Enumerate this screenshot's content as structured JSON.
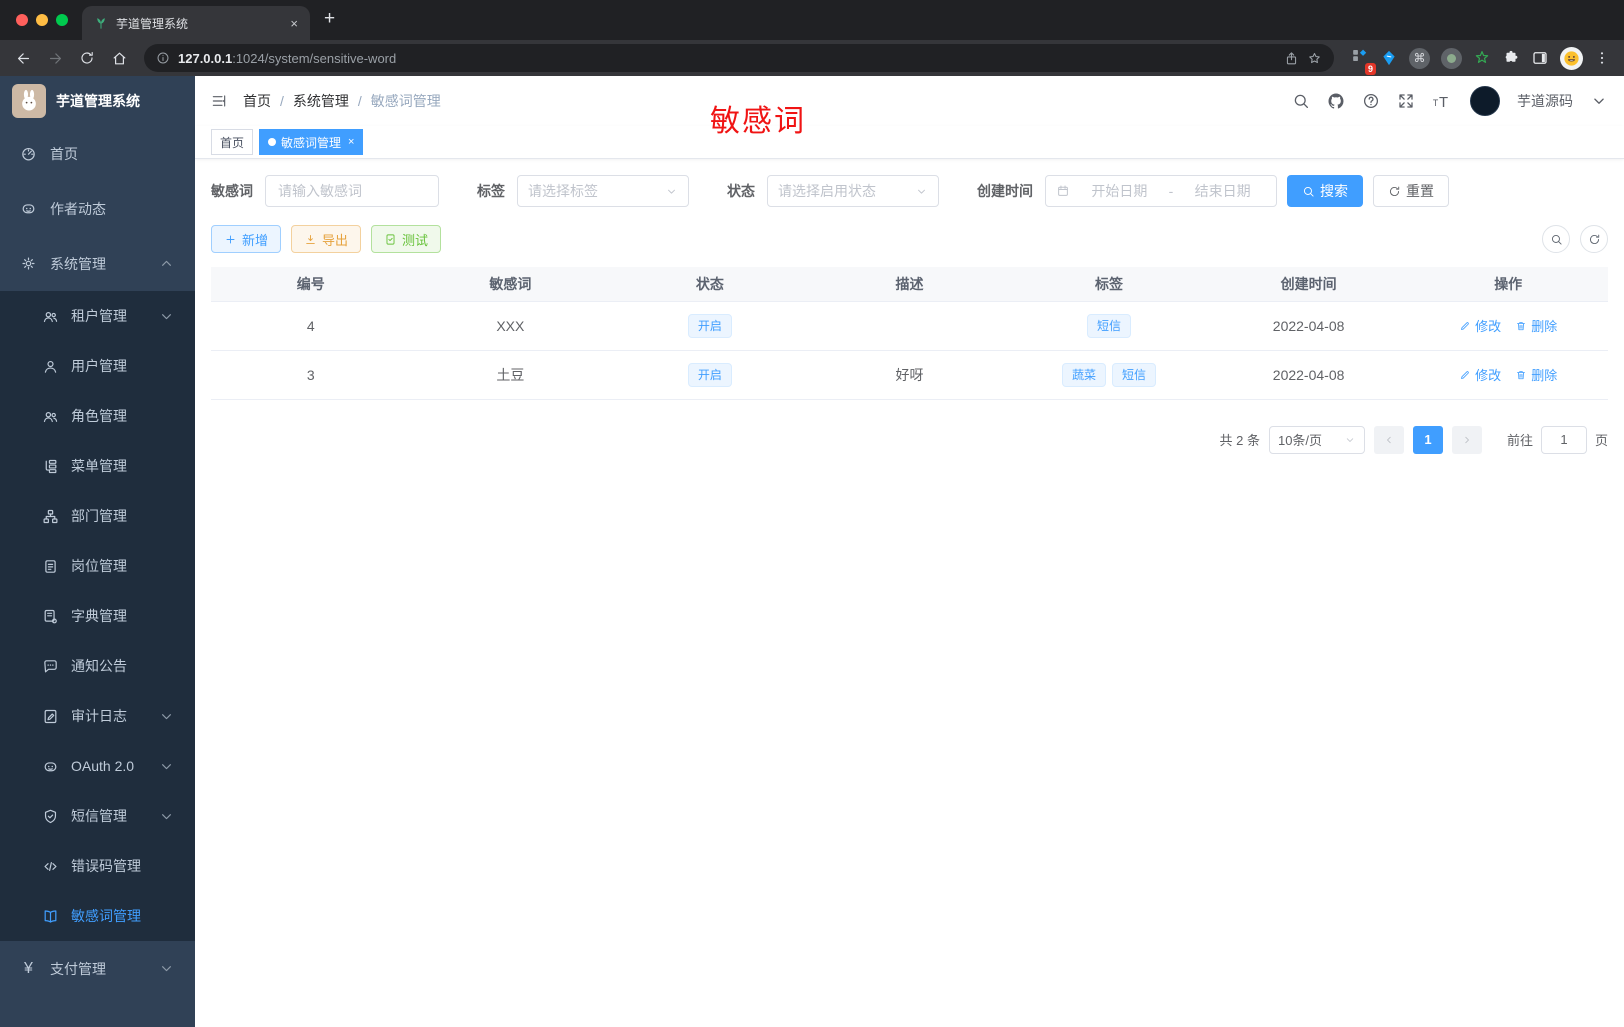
{
  "colors": {
    "accent": "#409eff",
    "annotation_red": "#f01414",
    "sidebar_bg": "#304156",
    "submenu_bg": "#1f2d3d",
    "warning": "#e6a23c",
    "success": "#67c23a"
  },
  "browser": {
    "tab_title": "芋道管理系统",
    "tab_close": "×",
    "new_tab": "+",
    "url_host": "127.0.0.1",
    "url_rest": ":1024/system/sensitive-word",
    "extension_badge": "9",
    "cmd_glyph": "⌘",
    "icons": [
      "back-icon",
      "forward-icon",
      "reload-icon",
      "home-icon",
      "info-icon",
      "share-icon",
      "star-icon",
      "extension-grid-icon",
      "kite-icon",
      "command-circle-icon",
      "record-circle-icon",
      "green-star-icon",
      "puzzle-icon",
      "side-panel-icon",
      "emoji-avatar",
      "kebab-menu-icon"
    ]
  },
  "sidebar": {
    "logo_title": "芋道管理系统",
    "top_items": [
      {
        "label": "首页",
        "icon": "dashboard-icon"
      },
      {
        "label": "作者动态",
        "icon": "robot-icon"
      },
      {
        "label": "系统管理",
        "icon": "gear-icon",
        "chevron": "up"
      }
    ],
    "submenu": [
      {
        "label": "租户管理",
        "icon": "tenants-icon",
        "chevron": "down"
      },
      {
        "label": "用户管理",
        "icon": "user-icon"
      },
      {
        "label": "角色管理",
        "icon": "roles-icon"
      },
      {
        "label": "菜单管理",
        "icon": "menu-tree-icon"
      },
      {
        "label": "部门管理",
        "icon": "org-chart-icon"
      },
      {
        "label": "岗位管理",
        "icon": "post-icon"
      },
      {
        "label": "字典管理",
        "icon": "dict-icon"
      },
      {
        "label": "通知公告",
        "icon": "notice-icon"
      },
      {
        "label": "审计日志",
        "icon": "audit-log-icon",
        "chevron": "down"
      },
      {
        "label": "OAuth 2.0",
        "icon": "oauth-icon",
        "chevron": "down"
      },
      {
        "label": "短信管理",
        "icon": "sms-shield-icon",
        "chevron": "down"
      },
      {
        "label": "错误码管理",
        "icon": "error-code-icon"
      },
      {
        "label": "敏感词管理",
        "icon": "open-book-icon",
        "active": true
      }
    ],
    "bottom_items": [
      {
        "label": "支付管理",
        "icon": "yen-icon",
        "chevron": "down",
        "yen": "¥"
      }
    ]
  },
  "header": {
    "breadcrumb": [
      "首页",
      "系统管理",
      "敏感词管理"
    ],
    "separator": "/",
    "user_name": "芋道源码",
    "icons": [
      "search-icon",
      "github-icon",
      "help-icon",
      "fullscreen-icon",
      "font-size-icon"
    ]
  },
  "annotation": "敏感词",
  "tags_bar": {
    "home": "首页",
    "active": "敏感词管理",
    "close": "×"
  },
  "filters": {
    "keyword_label": "敏感词",
    "keyword_placeholder": "请输入敏感词",
    "tag_label": "标签",
    "tag_placeholder": "请选择标签",
    "status_label": "状态",
    "status_placeholder": "请选择启用状态",
    "date_label": "创建时间",
    "date_start": "开始日期",
    "date_separator": "-",
    "date_end": "结束日期",
    "search_label": "搜索",
    "reset_label": "重置"
  },
  "toolbar": {
    "add_label": "新增",
    "export_label": "导出",
    "test_label": "测试"
  },
  "table": {
    "headers": [
      "编号",
      "敏感词",
      "状态",
      "描述",
      "标签",
      "创建时间",
      "操作"
    ],
    "rows": [
      {
        "id": "4",
        "word": "XXX",
        "status": "开启",
        "desc": "",
        "tags": [
          "短信"
        ],
        "created": "2022-04-08"
      },
      {
        "id": "3",
        "word": "土豆",
        "status": "开启",
        "desc": "好呀",
        "tags": [
          "蔬菜",
          "短信"
        ],
        "created": "2022-04-08"
      }
    ],
    "ops": {
      "edit": "修改",
      "delete": "删除"
    }
  },
  "pagination": {
    "total": "共 2 条",
    "page_size": "10条/页",
    "current_page": "1",
    "goto_label": "前往",
    "goto_value": "1",
    "unit_label": "页"
  }
}
